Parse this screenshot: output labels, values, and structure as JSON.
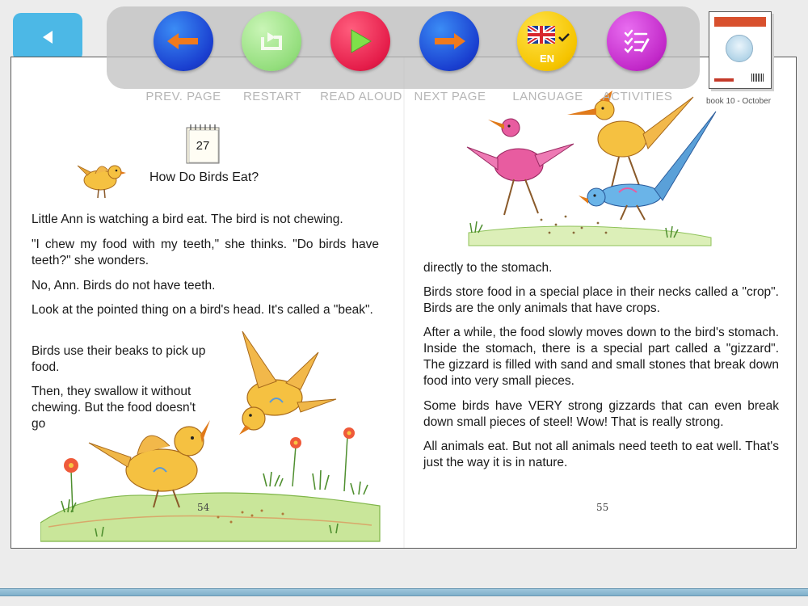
{
  "toolbar": {
    "buttons": [
      {
        "label": "PREV. PAGE"
      },
      {
        "label": "RESTART"
      },
      {
        "label": "READ ALOUD"
      },
      {
        "label": "NEXT PAGE"
      },
      {
        "label": "LANGUAGE",
        "code": "EN"
      },
      {
        "label": "ACTIVITIES"
      }
    ]
  },
  "book": {
    "cover_caption": "book 10 - October",
    "left_page": {
      "calendar_day": "27",
      "title": "How Do Birds Eat?",
      "paragraphs": [
        "Little Ann is watching a bird eat. The bird is not chewing.",
        "\"I chew my food with my teeth,\" she thinks. \"Do birds have teeth?\" she wonders.",
        "No, Ann. Birds do not have teeth.",
        "Look at the pointed thing on a bird's head. It's called a \"beak\".",
        "Birds use their beaks to pick up food.",
        "Then, they swallow it without chewing. But the food doesn't go"
      ],
      "page_number": "54"
    },
    "right_page": {
      "paragraphs": [
        "directly to the stomach.",
        "Birds store food in a special place in their necks called a \"crop\". Birds are the only animals that have crops.",
        "After a while, the food slowly moves down to the bird's stomach. Inside the stomach, there is a special part called a \"gizzard\". The gizzard is filled with sand and small stones that break down food into very small pieces.",
        "Some birds have VERY strong gizzards that can even break down small pieces of steel! Wow! That is really strong.",
        "All animals eat. But not all animals need teeth to eat well. That's just the way it is in nature."
      ],
      "page_number": "55"
    }
  },
  "icons": {
    "back": "back-arrow-icon",
    "prev": "arrow-left-icon",
    "restart": "restart-icon",
    "read": "play-icon",
    "next": "arrow-right-icon",
    "language": "uk-flag-icon",
    "activities": "checklist-icon"
  },
  "colors": {
    "back_button": "#4cb8e6",
    "prev_next": "#1a3fd0",
    "restart": "#94de7d",
    "read_aloud": "#e51d4a",
    "language": "#f5c400",
    "activities": "#c229c9",
    "arrow": "#f07a1c"
  }
}
